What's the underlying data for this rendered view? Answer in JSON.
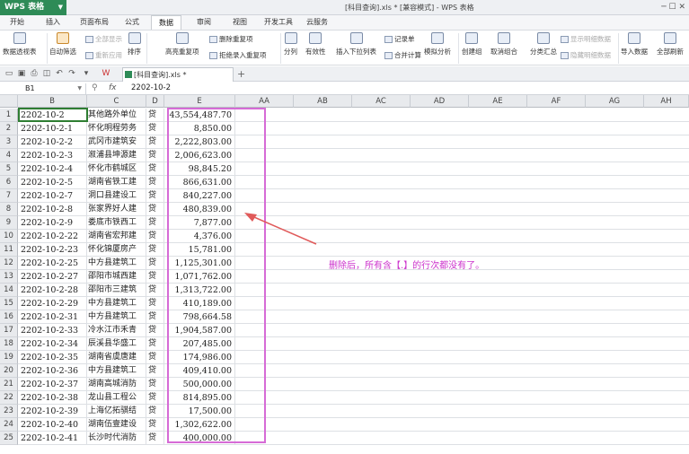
{
  "app": {
    "name": "WPS 表格",
    "doc_title": "[科目查询].xls * [兼容模式] - WPS 表格"
  },
  "menu": [
    "开始",
    "插入",
    "页面布局",
    "公式",
    "数据",
    "审阅",
    "视图",
    "开发工具",
    "云服务"
  ],
  "ribbon": {
    "pivot": "数据透视表",
    "auto_filter": "自动筛选",
    "show_all": "全部显示",
    "reapply": "重新应用",
    "sort": "排序",
    "highlight_dup": "高亮重复项",
    "delete_dup": "删除重复项",
    "reject_dup": "拒绝录入重复项",
    "split": "分列",
    "validity": "有效性",
    "dropdown": "插入下拉列表",
    "record": "记录单",
    "consolidate": "合并计算",
    "simulate": "模拟分析",
    "group": "创建组",
    "ungroup": "取消组合",
    "subtotal": "分类汇总",
    "show_detail": "显示明细数据",
    "hide_detail": "隐藏明细数据",
    "import": "导入数据",
    "refresh": "全部刷新"
  },
  "tabbar": {
    "doc_tab": "[科目查询].xls *",
    "add": "+"
  },
  "formula_bar": {
    "cell_ref": "B1",
    "fx": "fx",
    "value": "2202-10-2"
  },
  "columns": [
    "B",
    "C",
    "D",
    "E",
    "AA",
    "AB",
    "AC",
    "AD",
    "AE",
    "AF",
    "AG",
    "AH"
  ],
  "rows": [
    {
      "n": "1",
      "b": "2202-10-2",
      "c": "其他路外单位",
      "d": "贷",
      "e": "43,554,487.70"
    },
    {
      "n": "2",
      "b": "2202-10-2-1",
      "c": "怀化明程劳务",
      "d": "贷",
      "e": "8,850.00"
    },
    {
      "n": "3",
      "b": "2202-10-2-2",
      "c": "武冈市建筑安",
      "d": "贷",
      "e": "2,222,803.00"
    },
    {
      "n": "4",
      "b": "2202-10-2-3",
      "c": "溆浦县坤源建",
      "d": "贷",
      "e": "2,006,623.00"
    },
    {
      "n": "5",
      "b": "2202-10-2-4",
      "c": "怀化市鹤城区",
      "d": "贷",
      "e": "98,845.20"
    },
    {
      "n": "6",
      "b": "2202-10-2-5",
      "c": "湖南省铁工建",
      "d": "贷",
      "e": "866,631.00"
    },
    {
      "n": "7",
      "b": "2202-10-2-7",
      "c": "洞口县建设工",
      "d": "贷",
      "e": "840,227.00"
    },
    {
      "n": "8",
      "b": "2202-10-2-8",
      "c": "张家界好人建",
      "d": "贷",
      "e": "480,839.00"
    },
    {
      "n": "9",
      "b": "2202-10-2-9",
      "c": "娄底市铁西工",
      "d": "贷",
      "e": "7,877.00"
    },
    {
      "n": "10",
      "b": "2202-10-2-22",
      "c": "湖南省宏邦建",
      "d": "贷",
      "e": "4,376.00"
    },
    {
      "n": "11",
      "b": "2202-10-2-23",
      "c": "怀化锦厦房产",
      "d": "贷",
      "e": "15,781.00"
    },
    {
      "n": "12",
      "b": "2202-10-2-25",
      "c": "中方县建筑工",
      "d": "贷",
      "e": "1,125,301.00"
    },
    {
      "n": "13",
      "b": "2202-10-2-27",
      "c": "邵阳市城西建",
      "d": "贷",
      "e": "1,071,762.00"
    },
    {
      "n": "14",
      "b": "2202-10-2-28",
      "c": "邵阳市三建筑",
      "d": "贷",
      "e": "1,313,722.00"
    },
    {
      "n": "15",
      "b": "2202-10-2-29",
      "c": "中方县建筑工",
      "d": "贷",
      "e": "410,189.00"
    },
    {
      "n": "16",
      "b": "2202-10-2-31",
      "c": "中方县建筑工",
      "d": "贷",
      "e": "798,664.58"
    },
    {
      "n": "17",
      "b": "2202-10-2-33",
      "c": "冷水江市禾青",
      "d": "贷",
      "e": "1,904,587.00"
    },
    {
      "n": "18",
      "b": "2202-10-2-34",
      "c": "辰溪县华盛工",
      "d": "贷",
      "e": "207,485.00"
    },
    {
      "n": "19",
      "b": "2202-10-2-35",
      "c": "湖南省虞唐建",
      "d": "贷",
      "e": "174,986.00"
    },
    {
      "n": "20",
      "b": "2202-10-2-36",
      "c": "中方县建筑工",
      "d": "贷",
      "e": "409,410.00"
    },
    {
      "n": "21",
      "b": "2202-10-2-37",
      "c": "湖南高城消防",
      "d": "贷",
      "e": "500,000.00"
    },
    {
      "n": "22",
      "b": "2202-10-2-38",
      "c": "龙山县工程公",
      "d": "贷",
      "e": "814,895.00"
    },
    {
      "n": "23",
      "b": "2202-10-2-39",
      "c": "上海亿拓骐结",
      "d": "贷",
      "e": "17,500.00"
    },
    {
      "n": "24",
      "b": "2202-10-2-40",
      "c": "湖南伍壹建设",
      "d": "贷",
      "e": "1,302,622.00"
    },
    {
      "n": "25",
      "b": "2202-10-2-41",
      "c": "长沙时代消防",
      "d": "贷",
      "e": "400,000.00"
    }
  ],
  "annotation": "删除后，所有含【.】的行次都没有了。",
  "colors": {
    "accent": "#2e8b57",
    "annotation": "#cc33cc",
    "selection": "#d66bd6"
  }
}
